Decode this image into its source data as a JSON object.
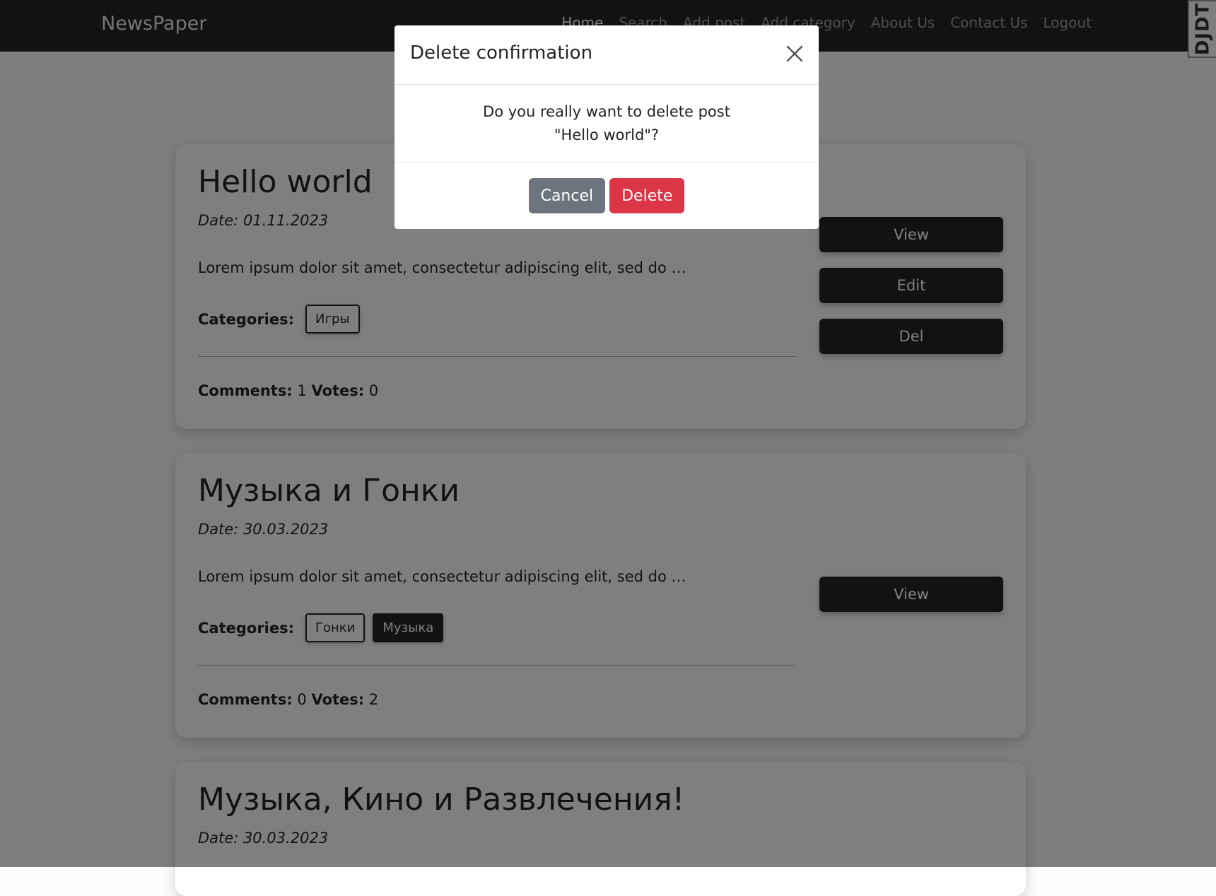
{
  "navbar": {
    "brand": "NewsPaper",
    "links": [
      "Home",
      "Search",
      "Add post",
      "Add category",
      "About Us",
      "Contact Us",
      "Logout"
    ],
    "djdt_label": "DJDT"
  },
  "posts": [
    {
      "title": "Hello world",
      "date": "Date: 01.11.2023",
      "excerpt": "Lorem ipsum dolor sit amet, consectetur adipiscing elit, sed do …",
      "categories_label": "Categories:",
      "categories": [
        "Игры"
      ],
      "comments_label": "Comments:",
      "comments": "1",
      "votes_label": "Votes:",
      "votes": "0",
      "actions": [
        "View",
        "Edit",
        "Del"
      ]
    },
    {
      "title": "Музыка и Гонки",
      "date": "Date: 30.03.2023",
      "excerpt": "Lorem ipsum dolor sit amet, consectetur adipiscing elit, sed do …",
      "categories_label": "Categories:",
      "categories": [
        "Гонки",
        "Музыка"
      ],
      "comments_label": "Comments:",
      "comments": "0",
      "votes_label": "Votes:",
      "votes": "2",
      "actions": [
        "View"
      ]
    },
    {
      "title": "Музыка, Кино и Развлечения!",
      "date": "Date: 30.03.2023"
    }
  ],
  "modal": {
    "title": "Delete confirmation",
    "body": "Do you really want to delete post \"Hello world\"?",
    "cancel_label": "Cancel",
    "delete_label": "Delete"
  },
  "icons": {
    "close": "close-icon"
  },
  "colors": {
    "navbar_bg": "#212529",
    "danger": "#dc3545",
    "secondary": "#6c757d"
  }
}
